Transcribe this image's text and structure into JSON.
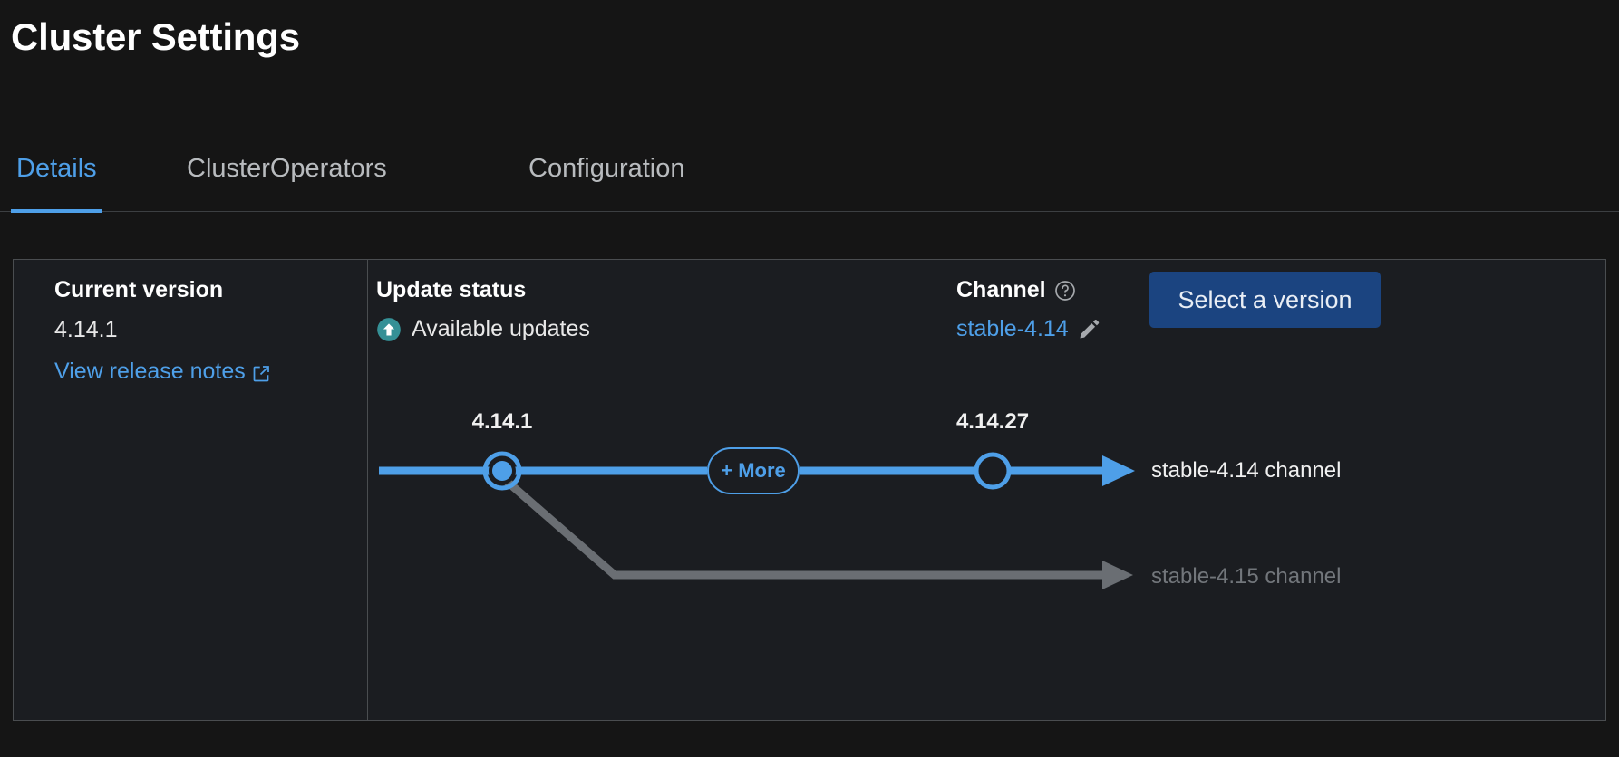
{
  "page": {
    "title": "Cluster Settings"
  },
  "tabs": [
    {
      "label": "Details",
      "active": true
    },
    {
      "label": "ClusterOperators",
      "active": false
    },
    {
      "label": "Configuration",
      "active": false
    }
  ],
  "current_version": {
    "heading": "Current version",
    "value": "4.14.1",
    "release_notes_link": "View release notes",
    "release_notes_icon": "external-link-icon"
  },
  "update_status": {
    "heading": "Update status",
    "status_text": "Available updates",
    "status_icon": "arrow-up-circle-icon",
    "status_icon_color": "#359096"
  },
  "channel": {
    "heading": "Channel",
    "help_icon": "help-circle-icon",
    "value": "stable-4.14",
    "edit_icon": "pencil-icon"
  },
  "actions": {
    "select_version_label": "Select a version",
    "select_version_color": "#1b4480"
  },
  "graph": {
    "more_button_label": "+ More",
    "nodes": [
      {
        "label": "4.14.1",
        "type": "current"
      },
      {
        "label": "4.14.27",
        "type": "available"
      }
    ],
    "channels": [
      {
        "label": "stable-4.14 channel",
        "state": "active",
        "color": "#4e9fe8"
      },
      {
        "label": "stable-4.15 channel",
        "state": "inactive",
        "color": "#6a6e73"
      }
    ]
  },
  "colors": {
    "accent_blue": "#4e9fe8",
    "background": "#151515",
    "card_background": "#1b1d21",
    "border": "#4a4d50",
    "muted_gray": "#6a6e73"
  }
}
